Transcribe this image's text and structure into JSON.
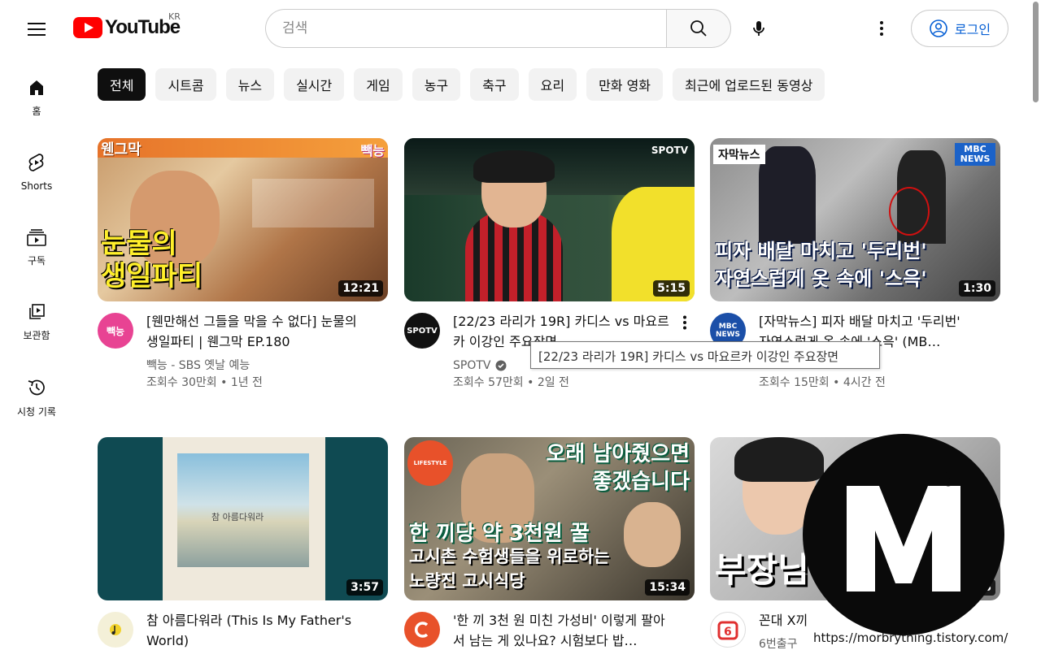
{
  "header": {
    "logo_text": "YouTube",
    "country": "KR",
    "search_placeholder": "검색",
    "login_label": "로그인"
  },
  "sidebar": {
    "items": [
      {
        "label": "홈",
        "icon": "home-icon"
      },
      {
        "label": "Shorts",
        "icon": "shorts-icon"
      },
      {
        "label": "구독",
        "icon": "subscriptions-icon"
      },
      {
        "label": "보관함",
        "icon": "library-icon"
      },
      {
        "label": "시청 기록",
        "icon": "history-icon"
      }
    ]
  },
  "chips": [
    "전체",
    "시트콤",
    "뉴스",
    "실시간",
    "게임",
    "농구",
    "축구",
    "요리",
    "만화 영화",
    "최근에 업로드된 동영상"
  ],
  "videos": [
    {
      "thumb_text_top": "웬그막",
      "thumb_text_main": "눈물의\n생일파티",
      "thumb_badge": "빽능",
      "duration": "12:21",
      "title": "[웬만해선 그들을 막을 수 없다] 눈물의 생일파티 | 웬그막 EP.180",
      "channel": "빽능 - SBS 옛날 예능",
      "stats": "조회수 30만회 • 1년 전",
      "avatar_text": "빽능"
    },
    {
      "thumb_badge": "SPOTV",
      "duration": "5:15",
      "title": "[22/23 라리가 19R] 카디스 vs 마요르카 이강인 주요장면",
      "channel": "SPOTV",
      "stats": "조회수 57만회 • 2일 전",
      "avatar_text": "SPOTV"
    },
    {
      "thumb_text_top": "자막뉴스",
      "thumb_text_main": "피자 배달 마치고 '두리번'\n자연스럽게 옷 속에 '스윽'",
      "thumb_badge": "MBC NEWS",
      "duration": "1:30",
      "title": "[자막뉴스] 피자 배달 마치고 '두리번' 자연스럽게 옷 속에 '스윽' (MB…",
      "channel": "MBCNEWS",
      "stats": "조회수 15만회 • 4시간 전",
      "avatar_text": "MBC NEWS"
    },
    {
      "thumb_text_main": "참 아름다워라",
      "duration": "3:57",
      "title": "참 아름다워라 (This Is My Father's World)",
      "channel": "",
      "stats": ""
    },
    {
      "thumb_text_top": "오래 남아줬으면\n좋겠습니다",
      "thumb_text_main": "한 끼당 약 3천원 꿀",
      "thumb_text_sub": "고시촌 수험생들을 위로하는\n노량진 고시식당",
      "thumb_badge": "LIFESTYLE",
      "duration": "15:34",
      "title": "'한 끼 3천 원 미친 가성비' 이렇게 팔아서 남는 게 있나요? 시험보다 밥…",
      "channel": "",
      "stats": ""
    },
    {
      "thumb_text_main": "부장님",
      "duration": "8",
      "title": "꼰대 X끼",
      "channel": "6번출구",
      "stats": ""
    }
  ],
  "tooltip": "[22/23 라리가 19R] 카디스 vs 마요르카 이강인 주요장면",
  "watermark": {
    "letter": "M",
    "superscript": "b",
    "url": "https://morbrything.tistory.com/"
  }
}
